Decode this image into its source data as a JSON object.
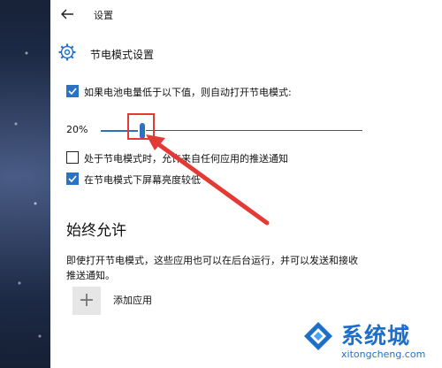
{
  "window": {
    "title": "设置"
  },
  "header": {
    "title": "节电模式设置",
    "icon": "gear-icon"
  },
  "battery_saver": {
    "auto_on_checkbox": {
      "label": "如果电池电量低于以下值，则自动打开节电模式:",
      "checked": true
    },
    "threshold": {
      "label": "20%",
      "value_percent": 20
    },
    "allow_push_checkbox": {
      "label": "处于节电模式时，允许来自任何应用的推送通知",
      "checked": false
    },
    "lower_brightness_checkbox": {
      "label": "在节电模式下屏幕亮度较低",
      "checked": true
    }
  },
  "always_allowed": {
    "title": "始终允许",
    "description": "即使打开节电模式，这些应用也可以在后台运行，并可以发送和接收推送通知。",
    "add_button_icon": "plus-icon",
    "add_label": "添加应用"
  },
  "annotation": {
    "highlight_color": "#e53935"
  },
  "watermark": {
    "title": "系统城",
    "url": "xitongcheng.com",
    "color": "#1f6fc8"
  },
  "colors": {
    "accent": "#2b73c2"
  }
}
